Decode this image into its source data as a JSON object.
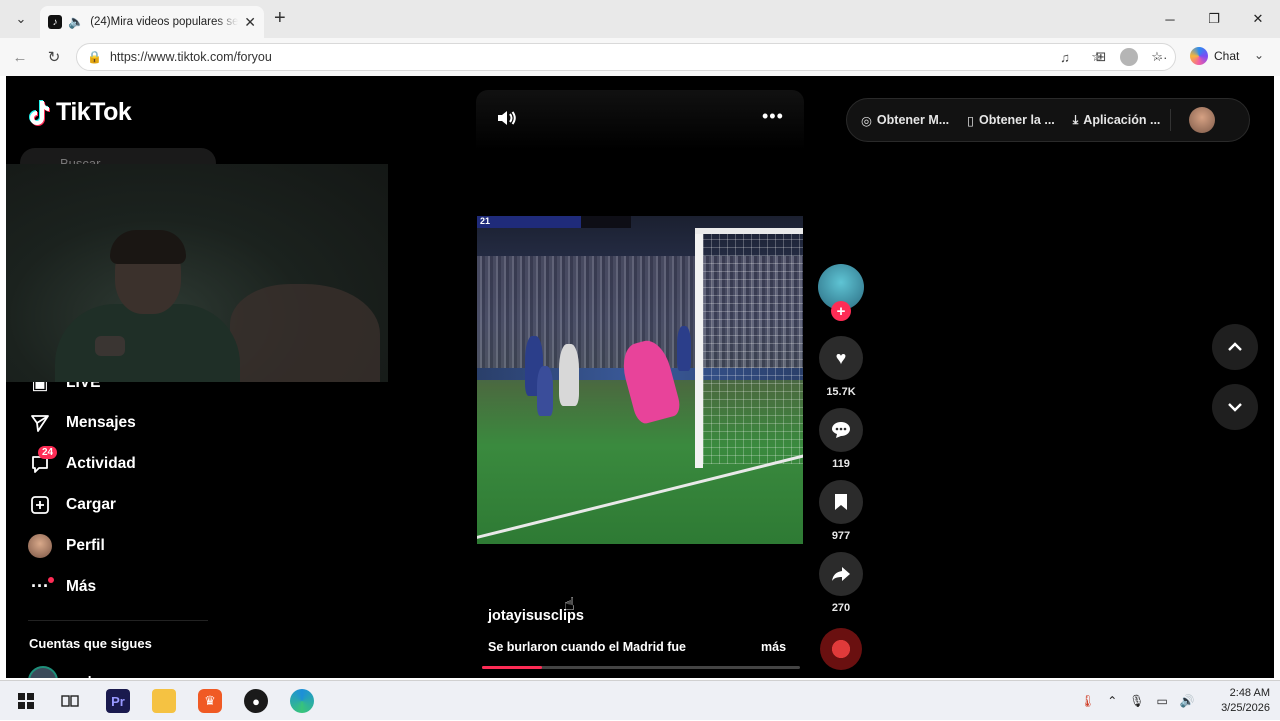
{
  "browser": {
    "tab_title": "(24)Mira videos populares sel",
    "tab_close": "✕",
    "new_tab": "+",
    "url": "https://www.tiktok.com/foryou",
    "chat_label": "Chat"
  },
  "tiktok": {
    "logo_text": "TikTok",
    "search_placeholder": "Buscar",
    "nav": {
      "live_label": "LIVE",
      "items": [
        {
          "label": "Mensajes",
          "icon": "send-icon"
        },
        {
          "label": "Actividad",
          "icon": "inbox-icon",
          "badge": "24"
        },
        {
          "label": "Cargar",
          "icon": "upload-icon"
        },
        {
          "label": "Perfil",
          "icon": "profile-avatar"
        },
        {
          "label": "Más",
          "icon": "more-dots-icon"
        }
      ]
    },
    "following_title": "Cuentas que sigues",
    "following_user": "paloma",
    "top_actions": {
      "item1": "Obtener M...",
      "item2": "Obtener la ...",
      "item3": "Aplicación ..."
    },
    "video": {
      "author": "jotayisusclips",
      "caption": "Se burlaron cuando el Madrid fue",
      "more": "más",
      "progress": 0.19,
      "scoreboard": "21"
    },
    "stats": {
      "likes": "15.7K",
      "comments": "119",
      "saves": "977",
      "shares": "270"
    }
  },
  "taskbar": {
    "time": "2:48 AM",
    "date": "3/25/2026"
  },
  "colors": {
    "tiktok_red": "#fe2c55",
    "page_bg": "#000000"
  }
}
